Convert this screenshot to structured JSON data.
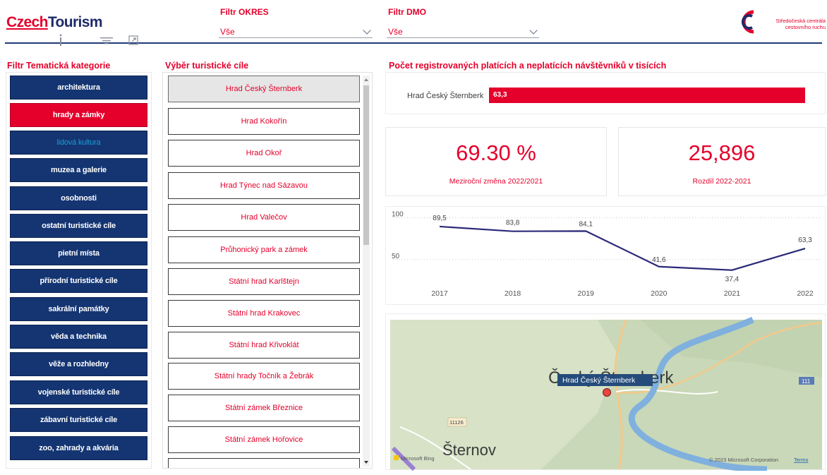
{
  "header": {
    "logo_part1": "Czech",
    "logo_part2": "Tourism",
    "filter_okres": {
      "label": "Filtr OKRES",
      "value": "Vše"
    },
    "filter_dmo": {
      "label": "Filtr DMO",
      "value": "Vše"
    },
    "partner_line1": "Středočeská centrála",
    "partner_line2": "cestovního ruchu",
    "colors": {
      "brand_red": "#e4002b",
      "brand_navy": "#1f2a69"
    },
    "icons": [
      "info-icon",
      "filter-icon",
      "focus-mode-icon"
    ]
  },
  "categories": {
    "title": "Filtr Tematická kategorie",
    "items": [
      "architektura",
      "hrady a zámky",
      "lidová kultura",
      "muzea a galerie",
      "osobnosti",
      "ostatní turistické cíle",
      "pietní místa",
      "přírodní turistické cíle",
      "sakrální památky",
      "věda a technika",
      "věže a rozhledny",
      "vojenské turistické cíle",
      "zábavní turistické cíle",
      "zoo, zahrady a akvária"
    ],
    "active": "hrady a zámky",
    "muted": "lidová kultura"
  },
  "destinations": {
    "title": "Výběr turistické cíle",
    "items": [
      "Hrad Český Šternberk",
      "Hrad Kokořín",
      "Hrad Okoř",
      "Hrad Týnec nad Sázavou",
      "Hrad Valečov",
      "Průhonický park a zámek",
      "Státní hrad Karlštejn",
      "Státní hrad Krakovec",
      "Státní hrad Křivoklát",
      "Státní hrady Točník a Žebrák",
      "Státní zámek Březnice",
      "Státní zámek Hořovice",
      ""
    ],
    "selected": "Hrad Český Šternberk"
  },
  "visitors": {
    "title": "Počet registrovaných platících a neplatících návštěvníků v tisících",
    "bar_label": "Hrad Český Šternberk",
    "bar_value": "63,3"
  },
  "kpis": [
    {
      "value": "69.30 %",
      "label": "Meziroční změna 2022/2021"
    },
    {
      "value": "25,896",
      "label": "Rozdíl 2022-2021"
    }
  ],
  "chart_data": {
    "type": "line",
    "x": [
      "2017",
      "2018",
      "2019",
      "2020",
      "2021",
      "2022"
    ],
    "series": [
      {
        "values": [
          89.5,
          83.8,
          84.1,
          41.6,
          37.4,
          63.3
        ],
        "labels": [
          "89,5",
          "83,8",
          "84,1",
          "41,6",
          "37,4",
          "63,3"
        ]
      }
    ],
    "y_ticks": [
      "100",
      "50"
    ],
    "y_tick_values": [
      100,
      50
    ],
    "ylim": [
      22,
      108
    ],
    "line_color": "#2a2a78",
    "grid": "dotted"
  },
  "map": {
    "town_label": "Český Šternberk",
    "town_label2": "Šternov",
    "pin_tooltip": "Hrad Český Šternberk",
    "road_badge": "111",
    "road_badge2": "11126",
    "attribution_left": "Microsoft Bing",
    "attribution_right": "© 2023 Microsoft Corporation",
    "attribution_link": "Terms"
  }
}
